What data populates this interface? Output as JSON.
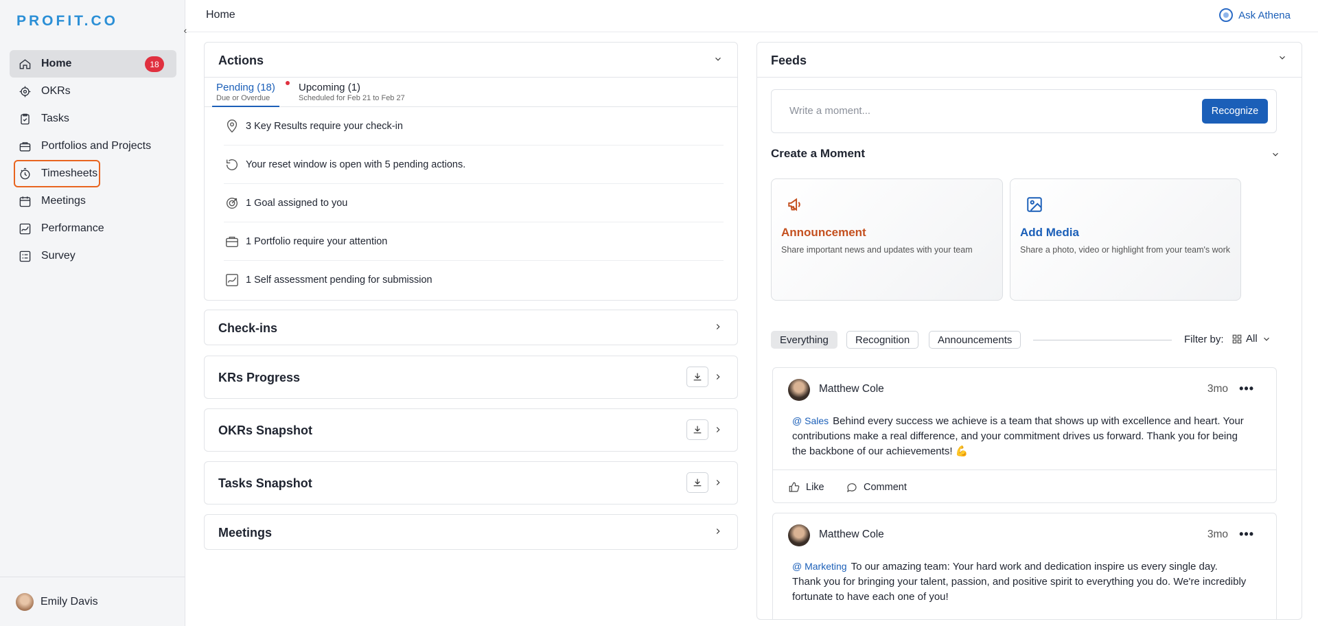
{
  "app": {
    "logo": "PROFIT.CO"
  },
  "sidebar": {
    "items": [
      {
        "label": "Home",
        "icon": "home-icon",
        "badge": "18"
      },
      {
        "label": "OKRs",
        "icon": "target-icon"
      },
      {
        "label": "Tasks",
        "icon": "clipboard-icon"
      },
      {
        "label": "Portfolios and Projects",
        "icon": "briefcase-icon"
      },
      {
        "label": "Timesheets",
        "icon": "stopwatch-icon"
      },
      {
        "label": "Meetings",
        "icon": "calendar-icon"
      },
      {
        "label": "Performance",
        "icon": "chart-line-icon"
      },
      {
        "label": "Survey",
        "icon": "list-icon"
      }
    ],
    "user": "Emily Davis"
  },
  "header": {
    "breadcrumb": "Home",
    "ask": "Ask Athena"
  },
  "actions": {
    "title": "Actions",
    "tabs": [
      {
        "label": "Pending (18)",
        "sub": "Due or Overdue"
      },
      {
        "label": "Upcoming (1)",
        "sub": "Scheduled for Feb 21 to Feb 27"
      }
    ],
    "items": [
      {
        "text": "3 Key Results require your check-in",
        "icon": "location-pin-icon"
      },
      {
        "text": "Your reset window is open with 5 pending actions.",
        "icon": "reset-icon"
      },
      {
        "text": "1 Goal assigned to you",
        "icon": "goal-icon"
      },
      {
        "text": "1 Portfolio require your attention",
        "icon": "briefcase-icon"
      },
      {
        "text": "1 Self assessment pending for submission",
        "icon": "assessment-icon"
      }
    ]
  },
  "sections": {
    "checkins": "Check-ins",
    "kr_progress": "KRs Progress",
    "okrs_snapshot": "OKRs Snapshot",
    "tasks_snapshot": "Tasks Snapshot",
    "meetings": "Meetings"
  },
  "feeds": {
    "title": "Feeds",
    "composer_placeholder": "Write a moment...",
    "recognize": "Recognize",
    "create_moment": "Create a Moment",
    "announcement": {
      "title": "Announcement",
      "desc": "Share important news and updates with your team",
      "color": "#c4501f"
    },
    "add_media": {
      "title": "Add Media",
      "desc": "Share a photo, video or highlight from your team's work",
      "color": "#1b5fb8"
    },
    "filters": [
      "Everything",
      "Recognition",
      "Announcements"
    ],
    "filter_by": "Filter by:",
    "filter_value": "All",
    "posts": [
      {
        "author": "Matthew Cole",
        "time": "3mo",
        "tag": "@ Sales",
        "text": "Behind every success we achieve is a team that shows up with excellence and heart. Your contributions make a real difference, and your commitment drives us forward. Thank you for being the backbone of our achievements! 💪",
        "like": "Like",
        "comment": "Comment"
      },
      {
        "author": "Matthew Cole",
        "time": "3mo",
        "tag": "@ Marketing",
        "text": "To our amazing team: Your hard work and dedication inspire us every single day. Thank you for bringing your talent, passion, and positive spirit to everything you do. We're incredibly fortunate to have each one of you!"
      }
    ]
  },
  "colors": {
    "accent": "#1b5fb8",
    "badge": "#e0303f",
    "highlight": "#e8641f"
  }
}
